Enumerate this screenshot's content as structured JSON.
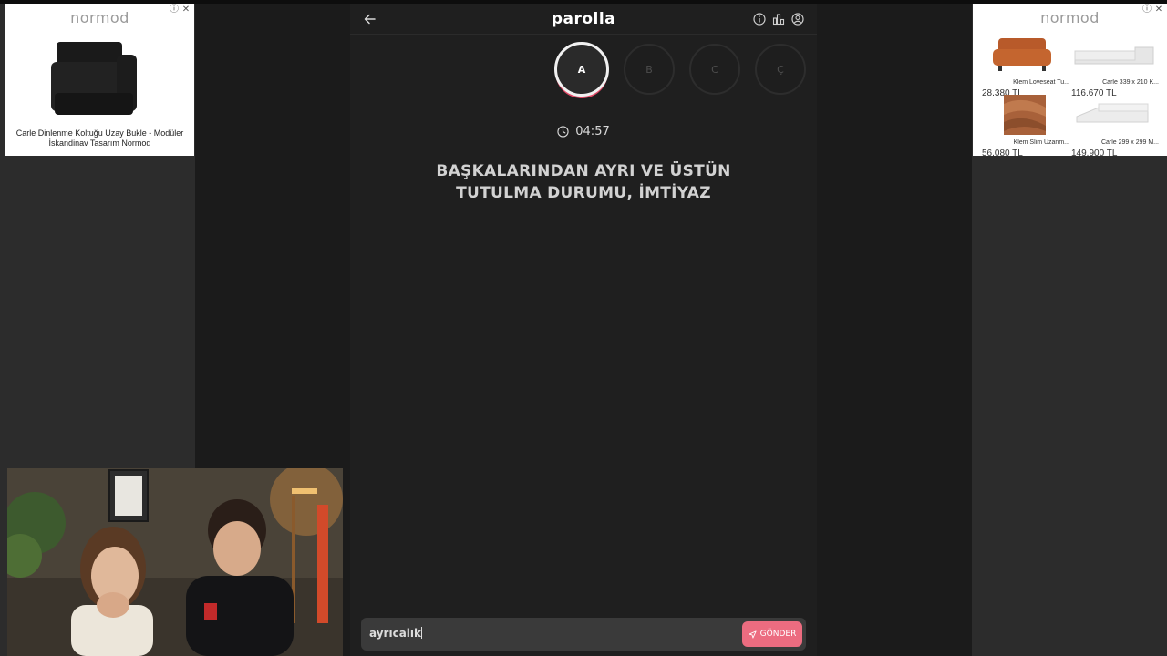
{
  "app": {
    "title": "parolla",
    "letters": [
      "A",
      "B",
      "C",
      "Ç"
    ],
    "active_letter_index": 0,
    "timer": "04:57",
    "question": "BAŞKALARINDAN AYRI VE ÜSTÜN TUTULMA DURUMU, İMTİYAZ",
    "answer_value": "ayrıcalık",
    "send_label": "GÖNDER",
    "icons": {
      "back": "arrow-left-icon",
      "info": "info-icon",
      "stats": "bar-chart-icon",
      "profile": "user-circle-icon",
      "timer": "clock-icon",
      "send": "send-icon"
    },
    "colors": {
      "accent": "#ec6c80",
      "background": "#1f1f1f"
    }
  },
  "ad_left": {
    "brand": "normod",
    "caption": "Carle Dinlenme Koltuğu Uzay Bukle - Modüler İskandinav Tasarım Normod"
  },
  "ad_right": {
    "brand": "normod",
    "products": [
      {
        "name": "Klem Loveseat Tu...",
        "price": "28.380 TL"
      },
      {
        "name": "Carle 339 x 210 K...",
        "price": "116.670 TL"
      },
      {
        "name": "Klem Slim Uzanm...",
        "price": "56.080 TL"
      },
      {
        "name": "Carle 299 x 299 M...",
        "price": "149.900 TL"
      }
    ]
  }
}
